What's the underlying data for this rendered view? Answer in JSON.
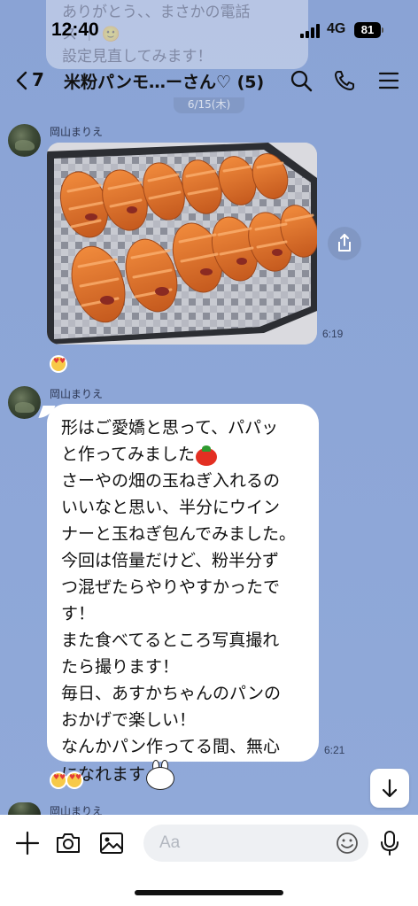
{
  "status": {
    "time": "12:40",
    "network": "4G",
    "battery": "81"
  },
  "notification": {
    "lines": [
      "ありがとう、、まさかの電話",
      "ス ｜ 🙂",
      "設定見直してみます！"
    ]
  },
  "header": {
    "back_count": "7",
    "title": "米粉パンモ…ーさん♡ (5)",
    "date_label": "6/15(木)"
  },
  "messages": [
    {
      "sender": "岡山まりえ",
      "type": "photo",
      "time": "6:19",
      "reaction_count": ""
    },
    {
      "sender": "岡山まりえ",
      "type": "text",
      "time": "6:21",
      "lines": [
        "形はご愛嬌と思って、パパッ",
        "と作ってみました",
        "さーやの畑の玉ねぎ入れるの",
        "いいなと思い、半分にウイン",
        "ナーと玉ねぎ包んでみました。",
        "今回は倍量だけど、粉半分ず",
        "つ混ぜたらやりやすかったで",
        "す！",
        "また食べてるところ写真撮れ",
        "たら撮ります！",
        "毎日、あすかちゃんのパンの",
        "おかげで楽しい！",
        "なんかパン作ってる間、無心",
        "になれます"
      ]
    },
    {
      "sender": "岡山まりえ",
      "type": "partial"
    }
  ],
  "input": {
    "placeholder": "Aa"
  },
  "icons": {
    "back": "chevron-left-icon",
    "search": "search-icon",
    "call": "phone-icon",
    "menu": "hamburger-menu-icon",
    "share": "share-icon",
    "scroll_down": "arrow-down-icon",
    "plus": "plus-icon",
    "camera": "camera-icon",
    "image": "image-icon",
    "emoji": "emoji-icon",
    "mic": "microphone-icon"
  },
  "colors": {
    "chat_background": "#8ba5d6",
    "bubble": "#ffffff",
    "input_bar": "#ffffff"
  }
}
